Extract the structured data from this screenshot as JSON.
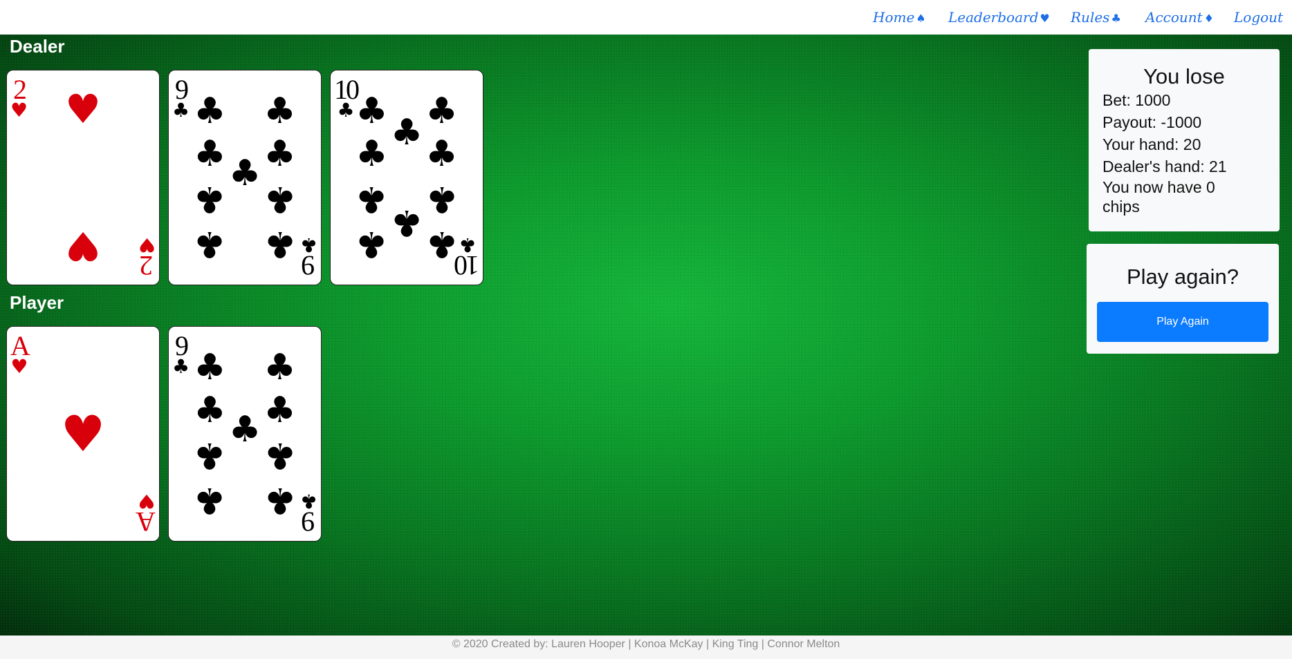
{
  "nav": {
    "items": [
      {
        "label": "Home",
        "suit": "♠"
      },
      {
        "label": "Leaderboard",
        "suit": "♥"
      },
      {
        "label": "Rules",
        "suit": "♣"
      },
      {
        "label": "Account",
        "suit": "♦"
      },
      {
        "label": "Logout",
        "suit": ""
      }
    ]
  },
  "dealer": {
    "label": "Dealer",
    "cards": [
      {
        "rank": "2",
        "suit": "♥",
        "color": "red"
      },
      {
        "rank": "9",
        "suit": "♣",
        "color": "black"
      },
      {
        "rank": "10",
        "suit": "♣",
        "color": "black"
      }
    ]
  },
  "player": {
    "label": "Player",
    "cards": [
      {
        "rank": "A",
        "suit": "♥",
        "color": "red"
      },
      {
        "rank": "9",
        "suit": "♣",
        "color": "black"
      }
    ]
  },
  "result": {
    "title": "You lose",
    "bet": "Bet: 1000",
    "payout": "Payout: -1000",
    "your_hand": "Your hand: 20",
    "dealer_hand": "Dealer's hand: 21",
    "chips_line1": "You now have 0",
    "chips_line2": "chips"
  },
  "play_again": {
    "title": "Play again?",
    "button_label": "Play Again"
  },
  "footer": {
    "text": "© 2020 Created by: Lauren Hooper | Konoa McKay | King Ting | Connor Melton"
  },
  "colors": {
    "link": "#1d6ee6",
    "felt": "#0c9a2c",
    "button": "#0b7bff",
    "red_suit": "#d8000b"
  }
}
